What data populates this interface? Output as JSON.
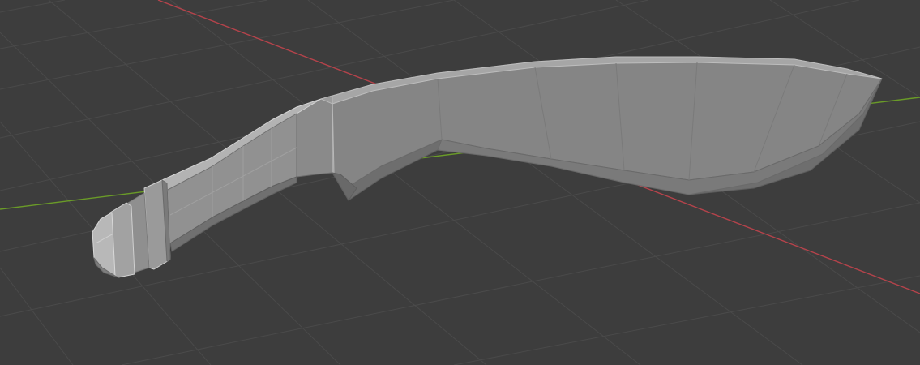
{
  "viewport": {
    "background": "#3d3d3d",
    "grid_color": "#4a4a4a",
    "x_axis_color": "#b5434b",
    "y_axis_color": "#6a9b28",
    "object": "kukri-knife-mesh",
    "shading": "solid",
    "mesh_colors": {
      "top": "#b0b0b0",
      "front": "#7c7c7c",
      "side": "#8e8e8e",
      "shadow": "#5e5e5e",
      "edge_highlight": "#d4d4d4",
      "edge": "#6a6a6a"
    }
  }
}
